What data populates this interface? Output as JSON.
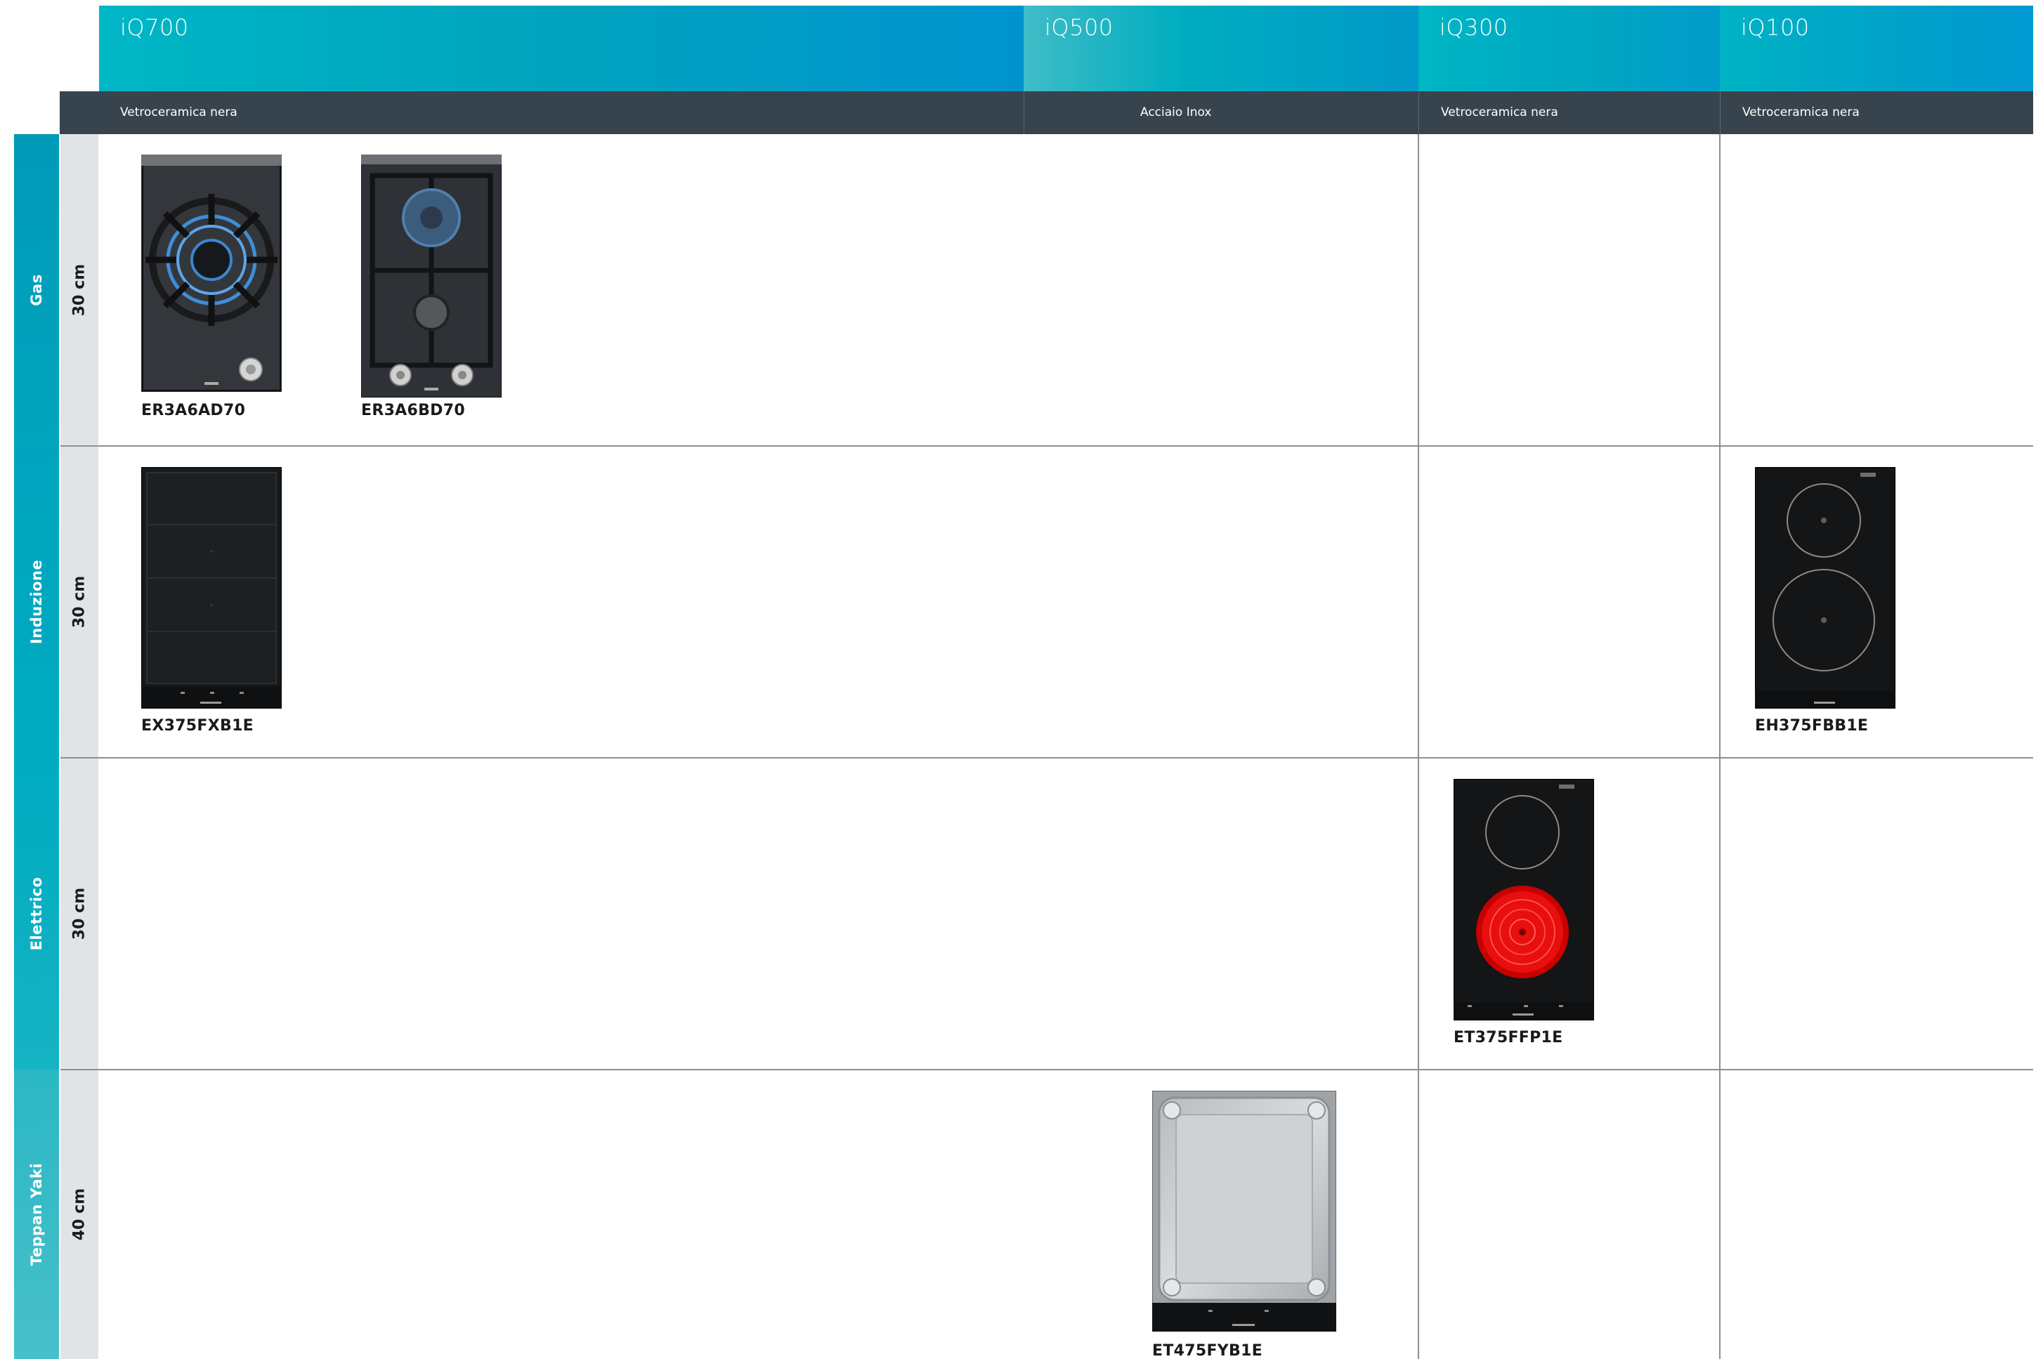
{
  "series": [
    {
      "label": "iQ700"
    },
    {
      "label": "iQ500"
    },
    {
      "label": "iQ300"
    },
    {
      "label": "iQ100"
    }
  ],
  "materials": [
    "Vetroceramica nera",
    "Acciaio Inox",
    "Vetroceramica nera",
    "Vetroceramica nera"
  ],
  "rows": [
    {
      "type": "Gas",
      "size": "30 cm"
    },
    {
      "type": "Induzione",
      "size": "30 cm"
    },
    {
      "type": "Elettrico",
      "size": "30 cm"
    },
    {
      "type": "Teppan Yaki",
      "size": "40 cm"
    }
  ],
  "products": {
    "gas_single": {
      "code": "ER3A6AD70",
      "icon": "gas-wok-burner-hob"
    },
    "gas_double": {
      "code": "ER3A6BD70",
      "icon": "gas-two-burner-hob"
    },
    "induction_flex": {
      "code": "EX375FXB1E",
      "icon": "flex-induction-hob"
    },
    "induction_two": {
      "code": "EH375FBB1E",
      "icon": "two-zone-induction-hob"
    },
    "electric": {
      "code": "ET375FFP1E",
      "icon": "ceramic-radiant-hob"
    },
    "teppan": {
      "code": "ET475FYB1E",
      "icon": "teppan-yaki-plate"
    }
  },
  "colors": {
    "header_teal": "#00b3c6",
    "header_blue": "#0096d0",
    "material_band": "#38444d",
    "size_column": "#e1e4e6",
    "hot_zone": "#e00000"
  }
}
